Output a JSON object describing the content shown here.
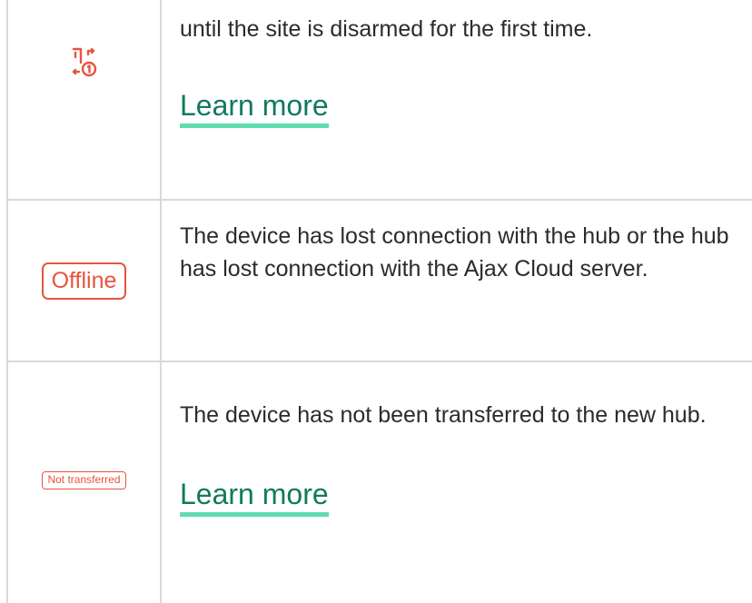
{
  "rows": [
    {
      "icon": "delay-after-arming-icon",
      "description": "until the site is disarmed for the first time.",
      "link_label": "Learn more"
    },
    {
      "badge": "Offline",
      "description": "The device has lost connection with the hub or the hub has lost connection with the Ajax Cloud server."
    },
    {
      "badge": "Not transferred",
      "description": "The device has not been transferred to the new hub.",
      "link_label": "Learn more"
    }
  ],
  "colors": {
    "accent_red": "#e8543f",
    "link_underline": "#5fdcae",
    "border": "#d9d9d9"
  }
}
